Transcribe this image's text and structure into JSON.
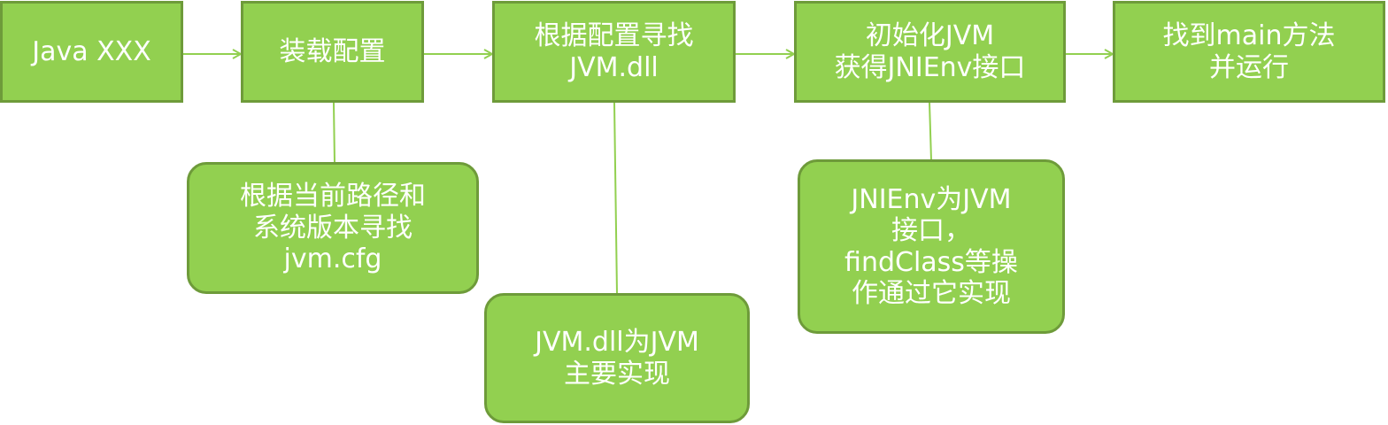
{
  "colors": {
    "box_fill": "#92d050",
    "box_border": "#6e9b3a",
    "connector": "#92d050",
    "text": "#ffffff"
  },
  "steps": [
    {
      "lines": [
        "Java XXX"
      ]
    },
    {
      "lines": [
        "装载配置"
      ]
    },
    {
      "lines": [
        "根据配置寻找",
        "JVM.dll"
      ]
    },
    {
      "lines": [
        "初始化JVM",
        "获得JNIEnv接口"
      ]
    },
    {
      "lines": [
        "找到main方法",
        "并运行"
      ]
    }
  ],
  "notes": [
    {
      "lines": [
        "根据当前路径和",
        "系统版本寻找",
        "jvm.cfg"
      ]
    },
    {
      "lines": [
        "JVM.dll为JVM",
        "主要实现"
      ]
    },
    {
      "lines": [
        "JNIEnv为JVM",
        "接口，",
        "findClass等操",
        "作通过它实现"
      ]
    }
  ]
}
